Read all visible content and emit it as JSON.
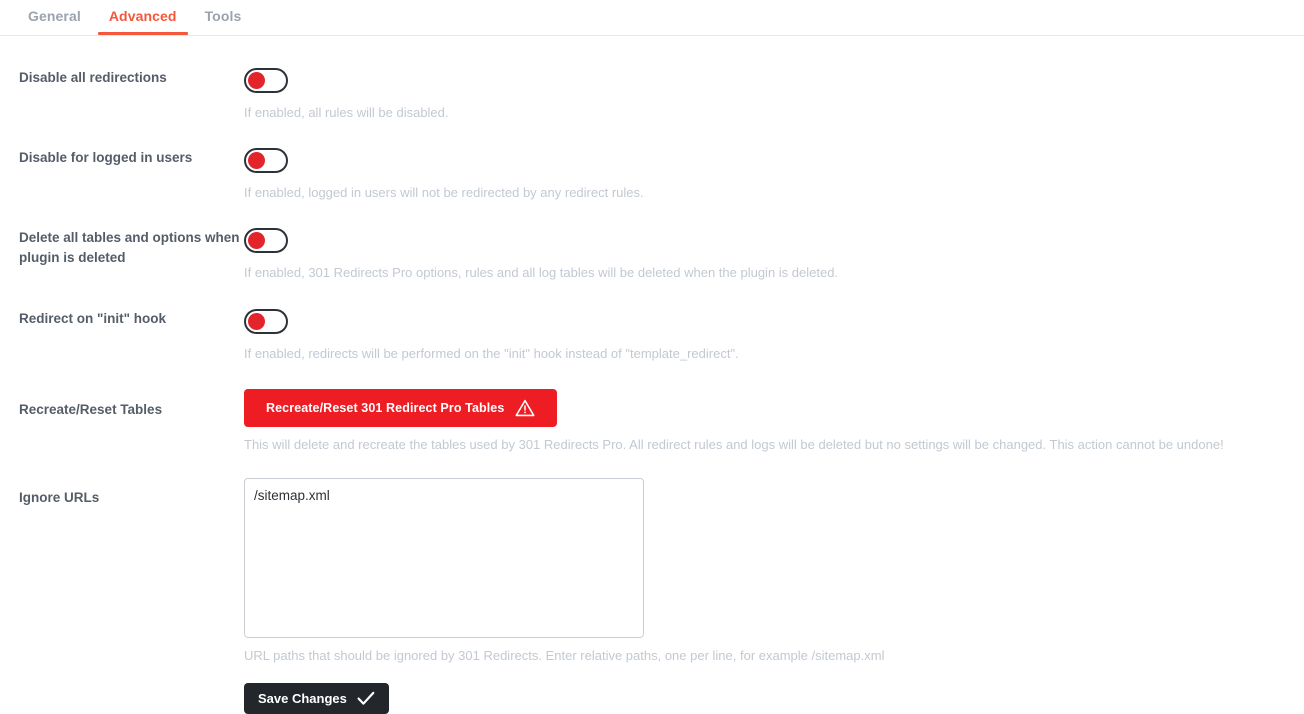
{
  "tabs": [
    {
      "label": "General",
      "active": false
    },
    {
      "label": "Advanced",
      "active": true
    },
    {
      "label": "Tools",
      "active": false
    }
  ],
  "colors": {
    "accent": "#f4573b",
    "danger": "#ee1c23",
    "toggle_knob": "#e3242b",
    "save_bg": "#23272c",
    "label": "#545d68",
    "help": "#c2c9d2"
  },
  "settings": {
    "disable_all_redirections": {
      "label": "Disable all redirections",
      "help": "If enabled, all rules will be disabled.",
      "state": "off"
    },
    "disable_for_logged_in": {
      "label": "Disable for logged in users",
      "help": "If enabled, logged in users will not be redirected by any redirect rules.",
      "state": "off"
    },
    "delete_all_tables": {
      "label": "Delete all tables and options when plugin is deleted",
      "help": "If enabled, 301 Redirects Pro options, rules and all log tables will be deleted when the plugin is deleted.",
      "state": "off"
    },
    "redirect_on_init": {
      "label": "Redirect on \"init\" hook",
      "help": "If enabled, redirects will be performed on the \"init\" hook instead of \"template_redirect\".",
      "state": "off"
    },
    "recreate_reset_tables": {
      "label": "Recreate/Reset Tables",
      "button_label": "Recreate/Reset 301 Redirect Pro Tables",
      "button_icon": "warning-triangle-icon",
      "help": "This will delete and recreate the tables used by 301 Redirects Pro. All redirect rules and logs will be deleted but no settings will be changed. This action cannot be undone!"
    },
    "ignore_urls": {
      "label": "Ignore URLs",
      "value": "/sitemap.xml",
      "placeholder": "",
      "help": "URL paths that should be ignored by 301 Redirects. Enter relative paths, one per line, for example /sitemap.xml"
    }
  },
  "actions": {
    "save_label": "Save Changes",
    "save_icon": "check-icon"
  }
}
